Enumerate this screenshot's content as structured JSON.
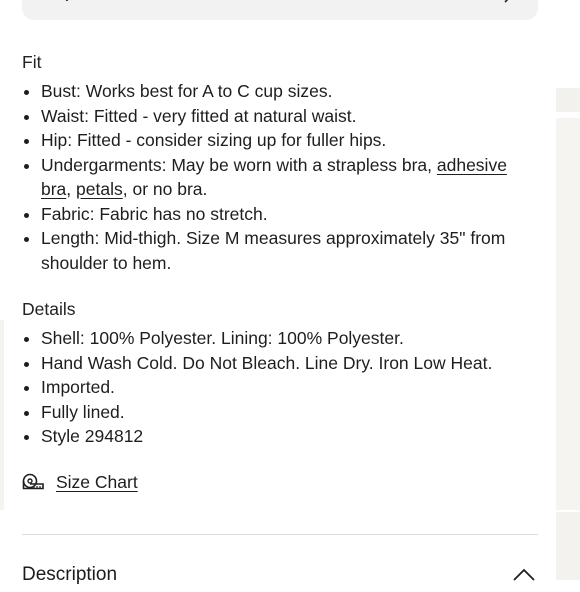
{
  "fit": {
    "title": "Fit",
    "items": [
      "Bust: Works best for A to C cup sizes.",
      "Waist: Fitted - very fitted at natural waist.",
      "Hip: Fitted - consider sizing up for fuller hips."
    ],
    "undergarments": {
      "prefix": "Undergarments: May be worn with a strapless bra, ",
      "link1": "adhesive bra",
      "sep": ", ",
      "link2": "petals",
      "suffix": ", or no bra."
    },
    "items2": [
      "Fabric: Fabric has no stretch.",
      "Length: Mid-thigh. Size M measures approximately 35\" from shoulder to hem."
    ]
  },
  "details": {
    "title": "Details",
    "items": [
      "Shell: 100% Polyester. Lining: 100% Polyester.",
      "Hand Wash Cold. Do Not Bleach. Line Dry. Iron Low Heat.",
      "Imported.",
      "Fully lined.",
      "Style 294812"
    ]
  },
  "size_chart": {
    "label": "Size Chart",
    "icon": "measuring-tape-icon"
  },
  "description": {
    "title": "Description",
    "icon": "chevron-up-icon"
  },
  "search": {
    "icon": "search-icon",
    "trailing_icon": "chevron-right-icon"
  },
  "colors": {
    "text": "#1e1e1e",
    "search_bg": "#f2f2f2",
    "divider": "#dcdcdc"
  }
}
